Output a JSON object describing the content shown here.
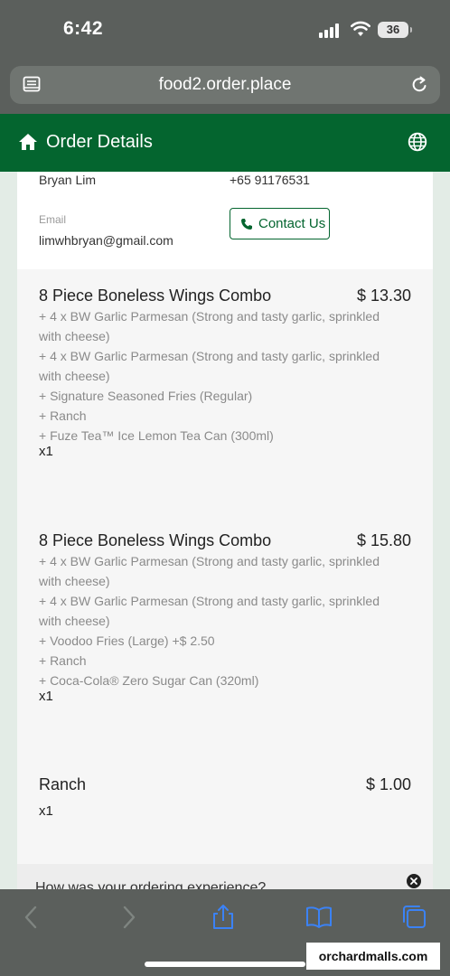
{
  "status": {
    "time": "6:42",
    "battery": "36"
  },
  "browser": {
    "url": "food2.order.place"
  },
  "header": {
    "title": "Order Details"
  },
  "customer": {
    "name": "Bryan Lim",
    "phone": "+65 91176531",
    "email_label": "Email",
    "email": "limwhbryan@gmail.com",
    "contact_label": "Contact Us"
  },
  "items": [
    {
      "name": "8 Piece Boneless Wings Combo",
      "price": "$ 13.30",
      "mods": [
        "+ 4 x BW Garlic Parmesan (Strong and tasty garlic, sprinkled with cheese)",
        "+ 4 x BW Garlic Parmesan (Strong and tasty garlic, sprinkled with cheese)",
        "+ Signature Seasoned Fries (Regular)",
        "+ Ranch",
        "+ Fuze Tea™ Ice Lemon Tea Can (300ml)"
      ],
      "qty": "x1"
    },
    {
      "name": "8 Piece Boneless Wings Combo",
      "price": "$ 15.80",
      "mods": [
        "+ 4 x BW Garlic Parmesan (Strong and tasty garlic, sprinkled with cheese)",
        "+ 4 x BW Garlic Parmesan (Strong and tasty garlic, sprinkled with cheese)",
        "+ Voodoo Fries (Large)  +$ 2.50",
        "+ Ranch",
        "+ Coca-Cola® Zero Sugar Can (320ml)"
      ],
      "qty": "x1"
    },
    {
      "name": "Ranch",
      "price": "$ 1.00",
      "mods": [],
      "qty": "x1"
    }
  ],
  "feedback": {
    "text": "How was your ordering experience?"
  },
  "watermark": "orchardmalls.com",
  "icons": {
    "home": "home-icon",
    "globe": "globe-icon",
    "phone": "phone-icon",
    "close": "close-icon",
    "back": "back-icon",
    "forward": "forward-icon",
    "share": "share-icon",
    "bookmarks": "bookmarks-icon",
    "tabs": "tabs-icon"
  },
  "colors": {
    "brand_green": "#04652f"
  }
}
